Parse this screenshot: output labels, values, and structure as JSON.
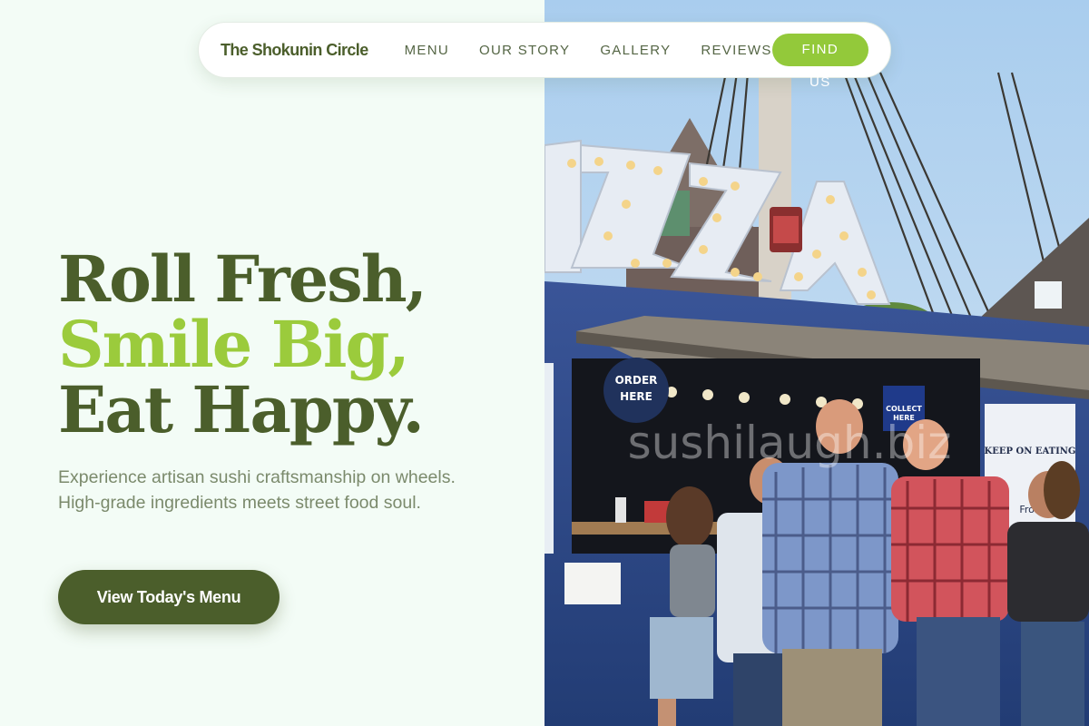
{
  "nav": {
    "brand": "The Shokunin Circle",
    "links": [
      {
        "label": "MENU"
      },
      {
        "label": "OUR STORY"
      },
      {
        "label": "GALLERY"
      },
      {
        "label": "REVIEWS"
      }
    ],
    "cta_label": "FIND US"
  },
  "hero": {
    "headline": [
      "Roll Fresh,",
      "Smile Big,",
      "Eat Happy."
    ],
    "subtitle": "Experience artisan sushi craftsmanship on wheels. High-grade ingredients meets street food soul.",
    "cta_label": "View Today's Menu"
  },
  "image": {
    "sign_letters": "IZZA",
    "order_sign": [
      "ORDER",
      "HERE"
    ],
    "collect_sign": [
      "COLLECT",
      "HERE"
    ],
    "poster_text": "KEEP ON EATING",
    "poster_sub": "Froe",
    "watermark": "sushilaugh.biz"
  },
  "colors": {
    "background": "#f3fcf6",
    "brand_dark": "#4b5e2b",
    "brand_accent": "#9bcb3c",
    "text_muted": "#7b8a6c",
    "truck_blue": "#2f4a8a"
  },
  "icons": {
    "image": "food-truck-photo"
  }
}
